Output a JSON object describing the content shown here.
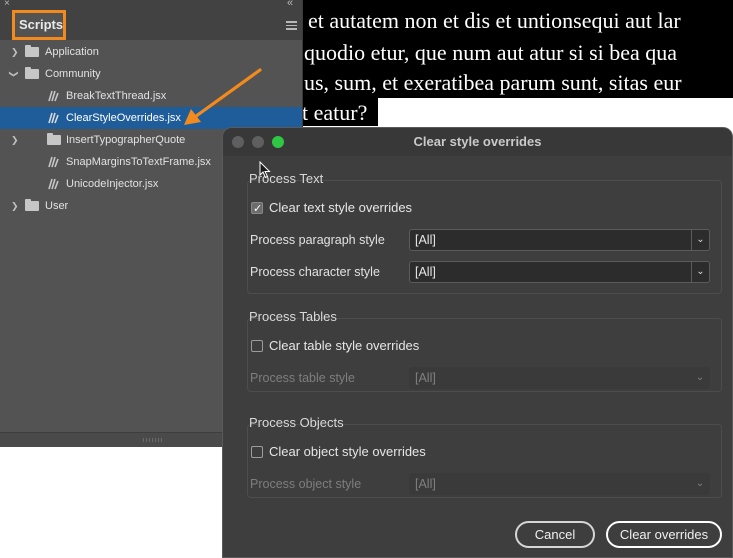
{
  "document": {
    "lines": [
      "et autatem non et dis et untionsequi aut lar",
      "quodio etur, que num aut atur si si bea qua",
      "us, sum, et exeratibea parum sunt, sitas eur",
      "t eatur?"
    ]
  },
  "scripts_panel": {
    "close_icon": "×",
    "collapse_icon": "«",
    "tab_label": "Scripts",
    "menu_icon": "hamburger-menu-icon",
    "items": [
      {
        "label": "Application",
        "type": "folder",
        "expanded": false
      },
      {
        "label": "Community",
        "type": "folder",
        "expanded": true
      },
      {
        "label": "BreakTextThread.jsx",
        "type": "script"
      },
      {
        "label": "ClearStyleOverrides.jsx",
        "type": "script",
        "selected": true
      },
      {
        "label": "InsertTypographerQuote",
        "type": "folder",
        "expanded": false
      },
      {
        "label": "SnapMarginsToTextFrame.jsx",
        "type": "script"
      },
      {
        "label": "UnicodeInjector.jsx",
        "type": "script"
      },
      {
        "label": "User",
        "type": "folder",
        "expanded": false
      }
    ]
  },
  "dialog": {
    "title": "Clear style overrides",
    "traffic_lights": {
      "close": "#5f5f5f",
      "minimize": "#5f5f5f",
      "zoom": "#2ec845"
    },
    "process_text": {
      "title": "Process Text",
      "checkbox_label": "Clear text style overrides",
      "checked": true,
      "paragraph_label": "Process paragraph style",
      "paragraph_value": "[All]",
      "character_label": "Process character style",
      "character_value": "[All]"
    },
    "process_tables": {
      "title": "Process Tables",
      "checkbox_label": "Clear table style overrides",
      "checked": false,
      "table_label": "Process table style",
      "table_value": "[All]"
    },
    "process_objects": {
      "title": "Process Objects",
      "checkbox_label": "Clear object style overrides",
      "checked": false,
      "object_label": "Process object style",
      "object_value": "[All]"
    },
    "cancel_label": "Cancel",
    "ok_label": "Clear overrides"
  },
  "colors": {
    "accent_orange": "#f28a1d",
    "selection_blue": "#1f5d9a"
  }
}
